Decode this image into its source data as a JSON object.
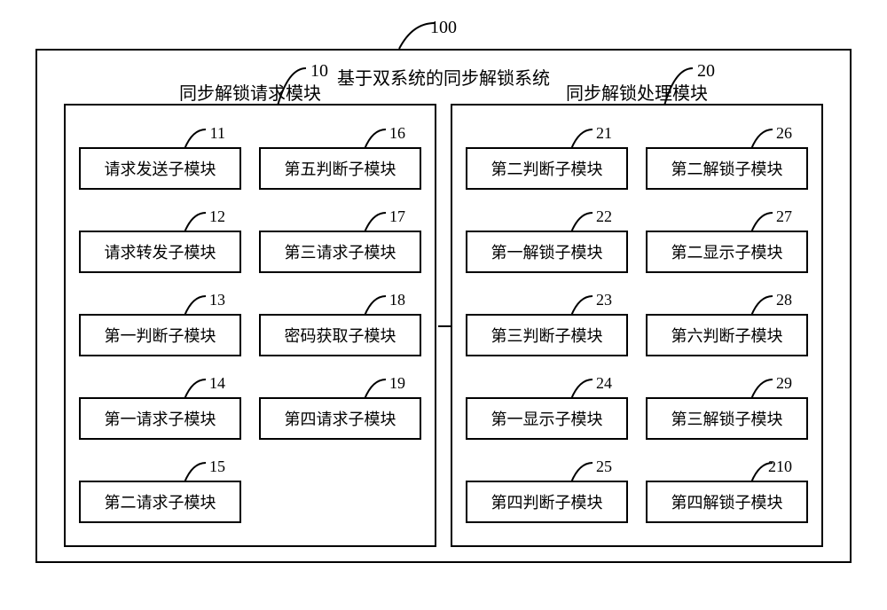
{
  "system": {
    "id": "100",
    "title": "基于双系统的同步解锁系统"
  },
  "left": {
    "id": "10",
    "title": "同步解锁请求模块",
    "col1": [
      {
        "num": "11",
        "label": "请求发送子模块"
      },
      {
        "num": "12",
        "label": "请求转发子模块"
      },
      {
        "num": "13",
        "label": "第一判断子模块"
      },
      {
        "num": "14",
        "label": "第一请求子模块"
      },
      {
        "num": "15",
        "label": "第二请求子模块"
      }
    ],
    "col2": [
      {
        "num": "16",
        "label": "第五判断子模块"
      },
      {
        "num": "17",
        "label": "第三请求子模块"
      },
      {
        "num": "18",
        "label": "密码获取子模块"
      },
      {
        "num": "19",
        "label": "第四请求子模块"
      }
    ]
  },
  "right": {
    "id": "20",
    "title": "同步解锁处理模块",
    "col1": [
      {
        "num": "21",
        "label": "第二判断子模块"
      },
      {
        "num": "22",
        "label": "第一解锁子模块"
      },
      {
        "num": "23",
        "label": "第三判断子模块"
      },
      {
        "num": "24",
        "label": "第一显示子模块"
      },
      {
        "num": "25",
        "label": "第四判断子模块"
      }
    ],
    "col2": [
      {
        "num": "26",
        "label": "第二解锁子模块"
      },
      {
        "num": "27",
        "label": "第二显示子模块"
      },
      {
        "num": "28",
        "label": "第六判断子模块"
      },
      {
        "num": "29",
        "label": "第三解锁子模块"
      },
      {
        "num": "210",
        "label": "第四解锁子模块"
      }
    ]
  }
}
